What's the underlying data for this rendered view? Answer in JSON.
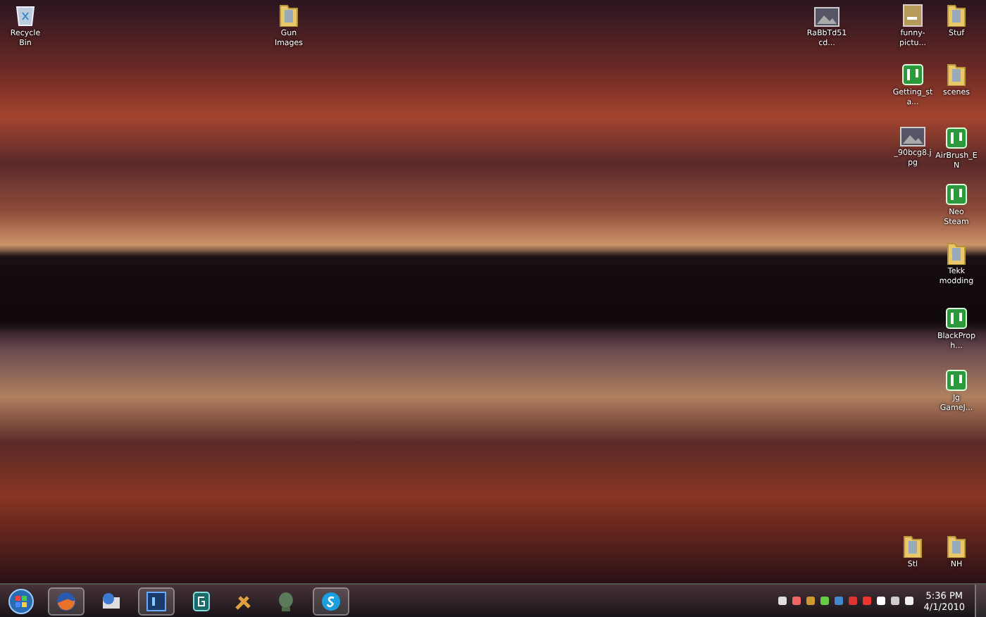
{
  "desktop_icons": [
    {
      "label": "Recycle Bin",
      "kind": "recycle"
    },
    {
      "label": "Gun Images",
      "kind": "folder"
    },
    {
      "label": "RaBbTd51cd...",
      "kind": "image"
    },
    {
      "label": "funny-pictu...",
      "kind": "file"
    },
    {
      "label": "Stuf",
      "kind": "folder"
    },
    {
      "label": "Getting_sta...",
      "kind": "app"
    },
    {
      "label": "scenes",
      "kind": "folder"
    },
    {
      "label": "_90bcg8.jpg",
      "kind": "image"
    },
    {
      "label": "AirBrush_EN",
      "kind": "app"
    },
    {
      "label": "Neo Steam",
      "kind": "app"
    },
    {
      "label": "Tekk modding",
      "kind": "folder"
    },
    {
      "label": "BlackProph...",
      "kind": "app"
    },
    {
      "label": "Jg GameJ...",
      "kind": "app"
    },
    {
      "label": "Stl",
      "kind": "folder"
    },
    {
      "label": "NH",
      "kind": "folder"
    }
  ],
  "taskbar": {
    "items": [
      {
        "kind": "start",
        "running": false
      },
      {
        "kind": "browser",
        "running": true
      },
      {
        "kind": "mail",
        "running": false
      },
      {
        "kind": "photo",
        "running": true
      },
      {
        "kind": "app",
        "running": false
      },
      {
        "kind": "tool",
        "running": false
      },
      {
        "kind": "game",
        "running": false
      },
      {
        "kind": "chat",
        "running": true
      }
    ],
    "clock": {
      "time": "5:36 PM",
      "date": "4/1/2010"
    }
  }
}
